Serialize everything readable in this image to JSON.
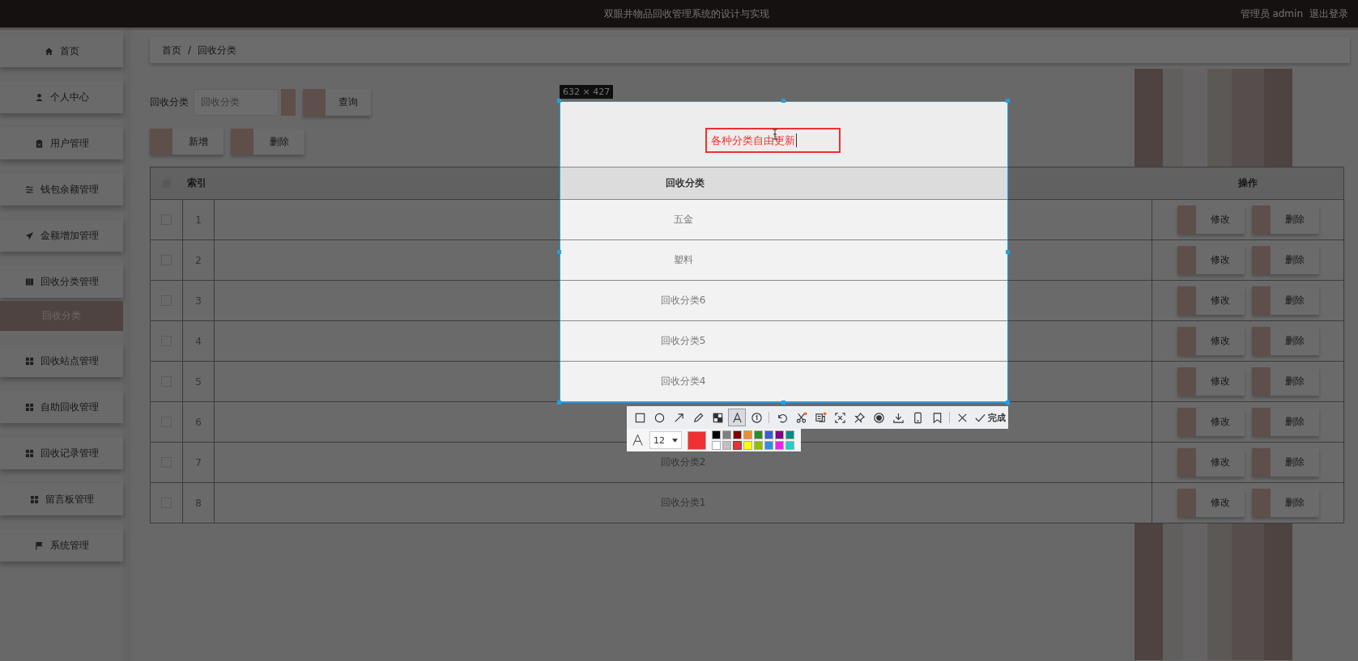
{
  "header": {
    "title": "双眼井物品回收管理系统的设计与实现",
    "user": "管理员 admin",
    "logout": "退出登录"
  },
  "sidebar": {
    "items": [
      {
        "label": "首页",
        "selected": false
      },
      {
        "label": "个人中心",
        "selected": false
      },
      {
        "label": "用户管理",
        "selected": false
      },
      {
        "label": "钱包余额管理",
        "selected": false
      },
      {
        "label": "金额增加管理",
        "selected": false
      },
      {
        "label": "回收分类管理",
        "selected": false,
        "children": [
          {
            "label": "回收分类",
            "selected": true
          }
        ]
      },
      {
        "label": "回收站点管理",
        "selected": false
      },
      {
        "label": "自助回收管理",
        "selected": false
      },
      {
        "label": "回收记录管理",
        "selected": false
      },
      {
        "label": "留言板管理",
        "selected": false
      },
      {
        "label": "系统管理",
        "selected": false
      }
    ]
  },
  "breadcrumb": {
    "items": [
      "首页",
      "回收分类"
    ],
    "separator": "/"
  },
  "search": {
    "label": "回收分类",
    "placeholder": "回收分类",
    "button": "查询"
  },
  "actions": [
    "新增",
    "删除"
  ],
  "table": {
    "all_checked": false,
    "columns": [
      "索引",
      "回收分类",
      "操作"
    ],
    "rows": [
      {
        "checked": false,
        "index": "1",
        "category": "五金",
        "buttons": [
          "修改",
          "删除"
        ]
      },
      {
        "checked": false,
        "index": "2",
        "category": "塑料",
        "buttons": [
          "修改",
          "删除"
        ]
      },
      {
        "checked": false,
        "index": "3",
        "category": "回收分类6",
        "buttons": [
          "修改",
          "删除"
        ]
      },
      {
        "checked": false,
        "index": "4",
        "category": "回收分类5",
        "buttons": [
          "修改",
          "删除"
        ]
      },
      {
        "checked": false,
        "index": "5",
        "category": "回收分类4",
        "buttons": [
          "修改",
          "删除"
        ]
      },
      {
        "checked": false,
        "index": "6",
        "buttons": [
          "修改",
          "删除"
        ]
      },
      {
        "checked": false,
        "index": "7",
        "category": "回收分类2",
        "buttons": [
          "修改",
          "删除"
        ]
      },
      {
        "checked": false,
        "index": "8",
        "category": "回收分类1",
        "buttons": [
          "修改",
          "删除"
        ]
      }
    ]
  },
  "capture": {
    "size": "632 × 427",
    "annotation": "各种分类自由更新",
    "tools": [
      {
        "kind": "rectangle",
        "selected": false
      },
      {
        "kind": "ellipse",
        "selected": false
      },
      {
        "kind": "arrow",
        "selected": false
      },
      {
        "kind": "pencil",
        "selected": false
      },
      {
        "kind": "mosaic",
        "selected": false
      },
      {
        "kind": "text",
        "selected": true
      },
      {
        "kind": "number",
        "selected": false
      },
      {
        "kind": "separator"
      },
      {
        "kind": "undo",
        "selected": false
      },
      {
        "kind": "scissors",
        "selected": false
      },
      {
        "kind": "ocr",
        "selected": false
      },
      {
        "kind": "expand",
        "selected": false
      },
      {
        "kind": "pin",
        "selected": false
      },
      {
        "kind": "record",
        "selected": false
      },
      {
        "kind": "download",
        "selected": false
      },
      {
        "kind": "phone",
        "selected": false
      },
      {
        "kind": "bookmark",
        "selected": false
      },
      {
        "kind": "separator"
      },
      {
        "kind": "close",
        "selected": false
      }
    ],
    "done": "完成",
    "font_size": "12",
    "palette": [
      {
        "color": "#000000",
        "selected": false
      },
      {
        "color": "#808080",
        "selected": false
      },
      {
        "color": "#800000",
        "selected": false
      },
      {
        "color": "#f08c30",
        "selected": false
      },
      {
        "color": "#2e8b2e",
        "selected": false
      },
      {
        "color": "#3a5cd0",
        "selected": false
      },
      {
        "color": "#800080",
        "selected": false
      },
      {
        "color": "#008b8b",
        "selected": false
      },
      {
        "color": "#ffffff",
        "selected": false
      },
      {
        "color": "#c0c0c0",
        "selected": false
      },
      {
        "color": "#f03030",
        "selected": true
      },
      {
        "color": "#ffff00",
        "selected": false
      },
      {
        "color": "#90c000",
        "selected": false
      },
      {
        "color": "#3090e0",
        "selected": false
      },
      {
        "color": "#f020f0",
        "selected": false
      },
      {
        "color": "#20d0d0",
        "selected": false
      }
    ]
  }
}
